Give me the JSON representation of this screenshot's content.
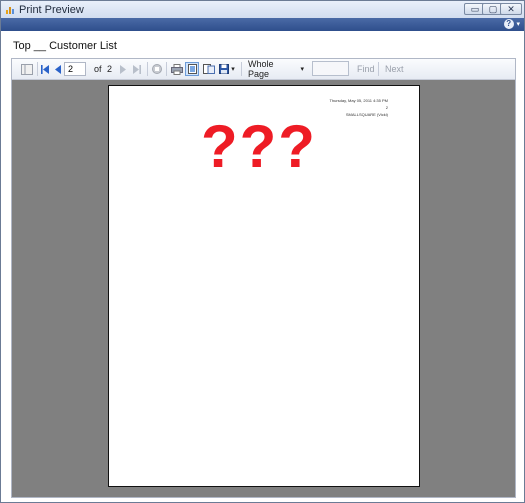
{
  "window": {
    "title": "Print Preview",
    "controls": {
      "minimize": "▭",
      "maximize": "▢",
      "close": "✕"
    },
    "help_label": "?"
  },
  "report": {
    "title": "Top __ Customer List"
  },
  "toolbar": {
    "current_page": "2",
    "of_label": "of",
    "total_pages": "2",
    "zoom": "Whole Page",
    "find_label": "Find",
    "next_label": "Next"
  },
  "preview_page": {
    "header_date": "Thursday, May 05, 2011 4:35 PM",
    "header_page": "2",
    "header_company": "SMALLSQUARE (Vicki)",
    "overlay_text": "???"
  },
  "colors": {
    "accent_bar": "#2f4f8c",
    "viewer_background": "#808080",
    "overlay_red": "#ee1c25"
  }
}
